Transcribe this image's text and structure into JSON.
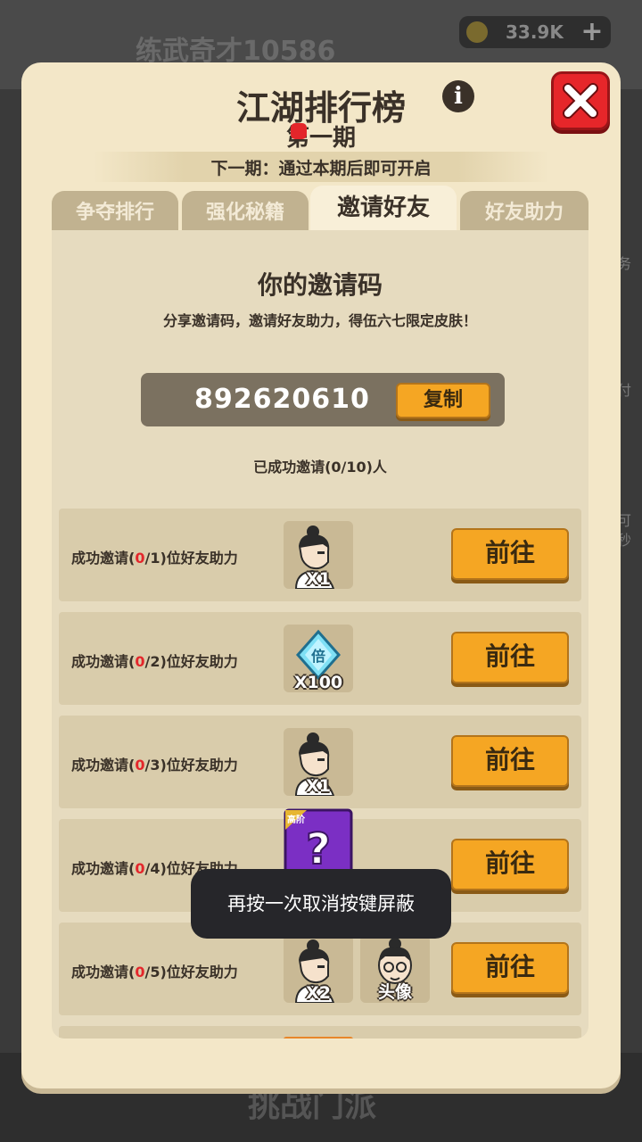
{
  "background": {
    "player_name": "练武奇才10586",
    "currency": "33.9K",
    "bottom_label": "挑战门派",
    "side_labels": [
      "务",
      "付",
      "可",
      "秒"
    ]
  },
  "modal": {
    "title": "江湖排行榜",
    "subtitle": "第一期",
    "next_period": "下一期：通过本期后即可开启"
  },
  "tabs": [
    {
      "label": "争夺排行",
      "active": false
    },
    {
      "label": "强化秘籍",
      "active": false,
      "badge": true
    },
    {
      "label": "邀请好友",
      "active": true
    },
    {
      "label": "好友助力",
      "active": false
    }
  ],
  "invite": {
    "heading": "你的邀请码",
    "description": "分享邀请码，邀请好友助力，得伍六七限定皮肤！",
    "code": "892620610",
    "copy_label": "复制",
    "invited_status": "已成功邀请(0/10)人"
  },
  "rewards": [
    {
      "prefix": "成功邀请(",
      "done": "0",
      "rest": "/1)位好友助力",
      "items": [
        {
          "icon": "character-avatar-icon",
          "count": "X1"
        }
      ],
      "button": "前往"
    },
    {
      "prefix": "成功邀请(",
      "done": "0",
      "rest": "/2)位好友助力",
      "items": [
        {
          "icon": "diamond-multiplier-icon",
          "count": "X100"
        }
      ],
      "button": "前往"
    },
    {
      "prefix": "成功邀请(",
      "done": "0",
      "rest": "/3)位好友助力",
      "items": [
        {
          "icon": "character-avatar-icon",
          "count": "X1"
        }
      ],
      "button": "前往"
    },
    {
      "prefix": "成功邀请(",
      "done": "0",
      "rest": "/4)位好友助力",
      "items": [
        {
          "icon": "mystery-box-icon",
          "count": "",
          "tag": "高阶"
        }
      ],
      "button": "前往"
    },
    {
      "prefix": "成功邀请(",
      "done": "0",
      "rest": "/5)位好友助力",
      "items": [
        {
          "icon": "character-avatar-icon",
          "count": "X2"
        },
        {
          "icon": "portrait-icon",
          "count": "头像"
        }
      ],
      "button": "前往"
    }
  ],
  "toast": "再按一次取消按键屏蔽",
  "colors": {
    "panel": "#f3e7c8",
    "accent_button": "#f5a623",
    "close_red": "#e6262a",
    "highlight_red": "#e3262b"
  }
}
